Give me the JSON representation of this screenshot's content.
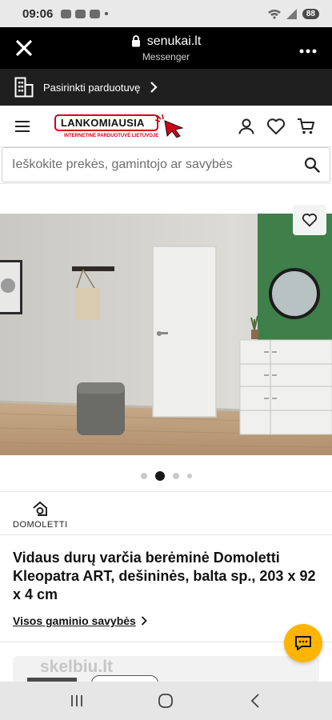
{
  "status_bar": {
    "time": "09:06",
    "battery": "88"
  },
  "browser": {
    "domain": "senukai.lt",
    "subtitle": "Messenger"
  },
  "store_bar": {
    "label": "Pasirinkti parduotuvę"
  },
  "header": {
    "logo_text": "LANKOMIAUSIA",
    "logo_tagline": "INTERNETINĖ PARDUOTUVĖ LIETUVOJE"
  },
  "search": {
    "placeholder": "Ieškokite prekės, gamintojo ar savybės"
  },
  "gallery": {
    "slide_count": 4,
    "active_slide": 2
  },
  "product": {
    "brand": "DOMOLETTI",
    "title": "Vidaus durų varčia berėminė Domoletti Kleopatra ART, dešininės, balta sp., 203 x 92 x 4 cm",
    "properties_link": "Visos gaminio savybės"
  },
  "watermark": "skelbiu.lt",
  "colors": {
    "accent_red": "#d0021b",
    "chat_yellow": "#ffb400",
    "wall_green": "#3f7f4a"
  },
  "icons": [
    "close-icon",
    "lock-icon",
    "more-icon",
    "store-icon",
    "chevron-right-icon",
    "menu-icon",
    "user-icon",
    "heart-icon",
    "cart-icon",
    "search-icon",
    "chat-icon",
    "recents-icon",
    "home-icon",
    "back-icon"
  ]
}
